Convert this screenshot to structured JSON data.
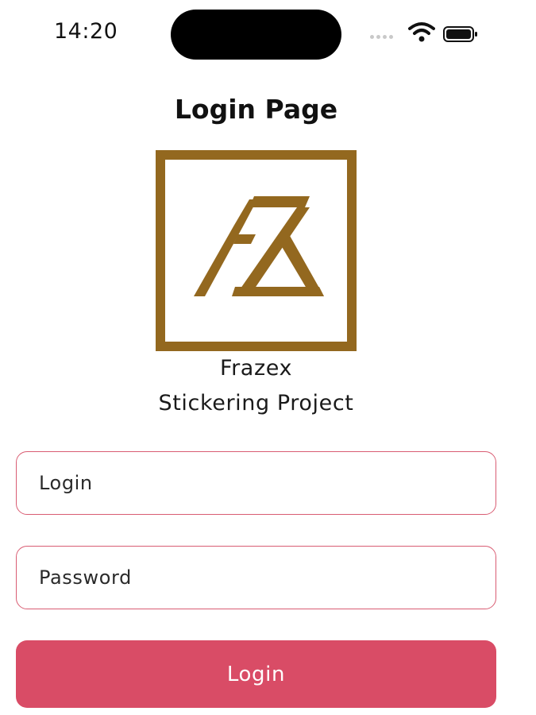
{
  "status_bar": {
    "time": "14:20",
    "icons": [
      "signal-icon",
      "wifi-icon",
      "battery-icon"
    ]
  },
  "title": "Login Page",
  "logo": {
    "icon": "frazex-logo-icon",
    "color": "#93681f"
  },
  "brand": {
    "name": "Frazex",
    "subtitle": "Stickering Project"
  },
  "form": {
    "login_placeholder": "Login",
    "login_value": "",
    "password_placeholder": "Password",
    "password_value": "",
    "submit_label": "Login"
  },
  "colors": {
    "accent": "#d94c66",
    "field_border": "#d95d73",
    "logo_gold": "#93681f",
    "text": "#111111"
  }
}
